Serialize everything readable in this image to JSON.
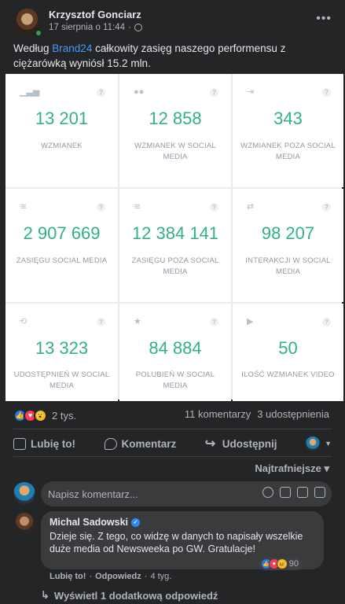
{
  "post": {
    "author": "Krzysztof Gonciarz",
    "date": "17 sierpnia o 11:44",
    "dot": "·",
    "more": "•••",
    "text_before": "Według ",
    "text_link": "Brand24",
    "text_after": " całkowity zasięg naszego performensu z ciężarówką wyniósł 15.2 mln."
  },
  "stats_grid": [
    {
      "icon": "bar-chart-icon",
      "value": "13 201",
      "label": "WZMIANEK"
    },
    {
      "icon": "people-icon",
      "value": "12 858",
      "label": "WZMIANEK W SOCIAL MEDIA"
    },
    {
      "icon": "signout-icon",
      "value": "343",
      "label": "WZMIANEK POZA SOCIAL MEDIA"
    },
    {
      "icon": "wifi-icon",
      "value": "2 907 669",
      "label": "ZASIĘGU SOCIAL MEDIA"
    },
    {
      "icon": "wifi-icon",
      "value": "12 384 141",
      "label": "ZASIĘGU POZA SOCIAL MEDIA"
    },
    {
      "icon": "exchange-icon",
      "value": "98 207",
      "label": "INTERAKCJI W SOCIAL MEDIA"
    },
    {
      "icon": "retweet-icon",
      "value": "13 323",
      "label": "UDOSTĘPNIEŃ W SOCIAL MEDIA"
    },
    {
      "icon": "star-icon",
      "value": "84 884",
      "label": "POLUBIEŃ W SOCIAL MEDIA"
    },
    {
      "icon": "play-icon",
      "value": "50",
      "label": "ILOŚĆ WZMIANEK VIDEO"
    }
  ],
  "help_mark": "?",
  "reactions": {
    "count": "2 tys.",
    "comments": "11 komentarzy",
    "shares": "3 udostępnienia"
  },
  "actions": {
    "like": "Lubię to!",
    "comment": "Komentarz",
    "share": "Udostępnij"
  },
  "sort": "Najtrafniejsze ▾",
  "comment_input": {
    "placeholder": "Napisz komentarz..."
  },
  "comment": {
    "author": "Michal Sadowski",
    "text": "Dzieje się. Z tego, co widzę w danych to napisały wszelkie duże media od Newsweeka po GW. Gratulacje!",
    "reaction_count": "90",
    "like": "Lubię to!",
    "sep": "·",
    "reply": "Odpowiedz",
    "time": "4 tyg."
  },
  "more_replies": "Wyświetl 1 dodatkową odpowiedź",
  "colors": {
    "accent": "#31b189",
    "link": "#4599ff",
    "bg": "#242526"
  }
}
